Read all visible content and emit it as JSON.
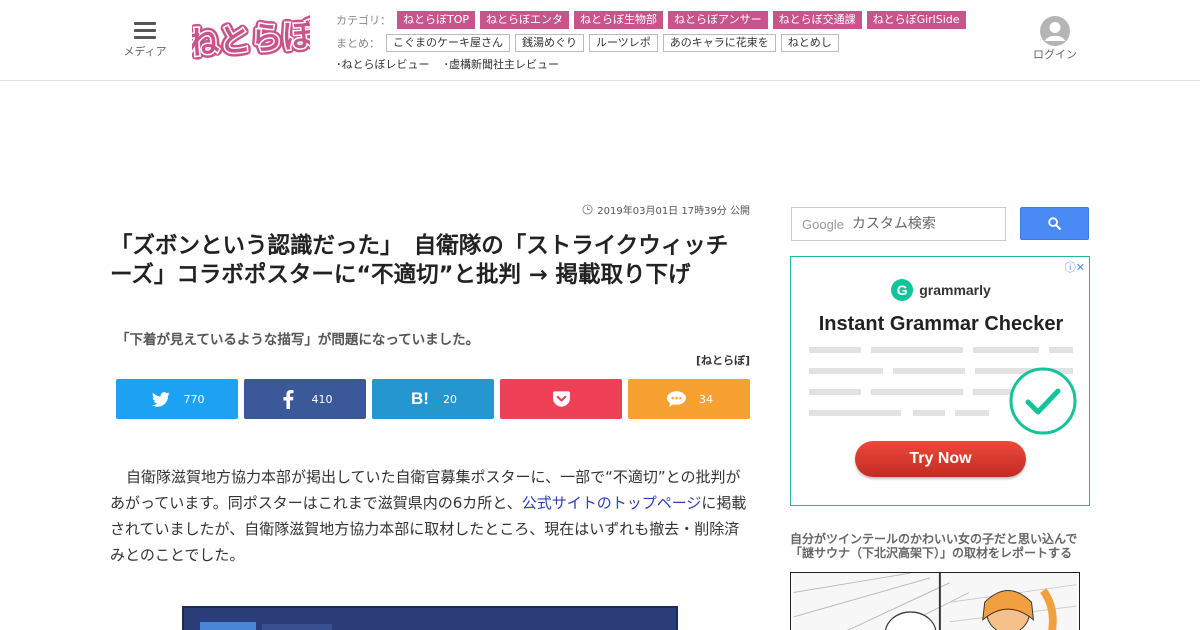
{
  "header": {
    "menu_label": "メディア",
    "logo_text": "ねとらぼ",
    "category_label": "カテゴリ：",
    "categories": [
      "ねとらぼTOP",
      "ねとらぼエンタ",
      "ねとらぼ生物部",
      "ねとらぼアンサー",
      "ねとらぼ交通課",
      "ねとらぼGirlSide"
    ],
    "summary_label": "まとめ：",
    "summaries": [
      "こぐまのケーキ屋さん",
      "銭湯めぐり",
      "ルーツレポ",
      "あのキャラに花束を",
      "ねとめし"
    ],
    "reviews": [
      "･ねとらぼレビュー",
      "･虚構新聞社主レビュー"
    ],
    "login_label": "ログイン",
    "brand_color": "#c8548c"
  },
  "article": {
    "published": "2019年03月01日 17時39分 公開",
    "title": "「ズボンという認識だった」　自衛隊の「ストライクウィッチーズ」コラボポスターに“不適切”と批判 → 掲載取り下げ",
    "subtitle": "「下着が見えているような描写」が問題になっていました。",
    "source": "[ねとらぼ]",
    "body_before_link": "自衛隊滋賀地方協力本部が掲出していた自衛官募集ポスターに、一部で“不適切”との批判があがっています。同ポスターはこれまで滋賀県内の6カ所と、",
    "body_link": "公式サイトのトップページ",
    "body_after_link": "に掲載されていましたが、自衛隊滋賀地方協力本部に取材したところ、現在はいずれも撤去・削除済みとのことでした。"
  },
  "share": {
    "twitter": {
      "icon": "twitter-icon",
      "count": "770",
      "color": "#1da1f2"
    },
    "facebook": {
      "icon": "facebook-icon",
      "count": "410",
      "color": "#3b5998"
    },
    "hatena": {
      "icon": "hatena-bookmark-icon",
      "mark": "B!",
      "count": "20",
      "color": "#2496d0"
    },
    "pocket": {
      "icon": "pocket-icon",
      "color": "#ee4056"
    },
    "comment": {
      "icon": "comment-icon",
      "count": "34",
      "color": "#f7a133"
    }
  },
  "sidebar": {
    "search_brand": "Google",
    "search_placeholder": "カスタム検索",
    "ad": {
      "brand": "grammarly",
      "brand_mark": "G",
      "headline": "Instant Grammar Checker",
      "cta": "Try Now"
    },
    "caption": "自分がツインテールのかわいい女の子だと思い込んで「謎サウナ（下北沢高架下）」の取材をレポートする"
  }
}
